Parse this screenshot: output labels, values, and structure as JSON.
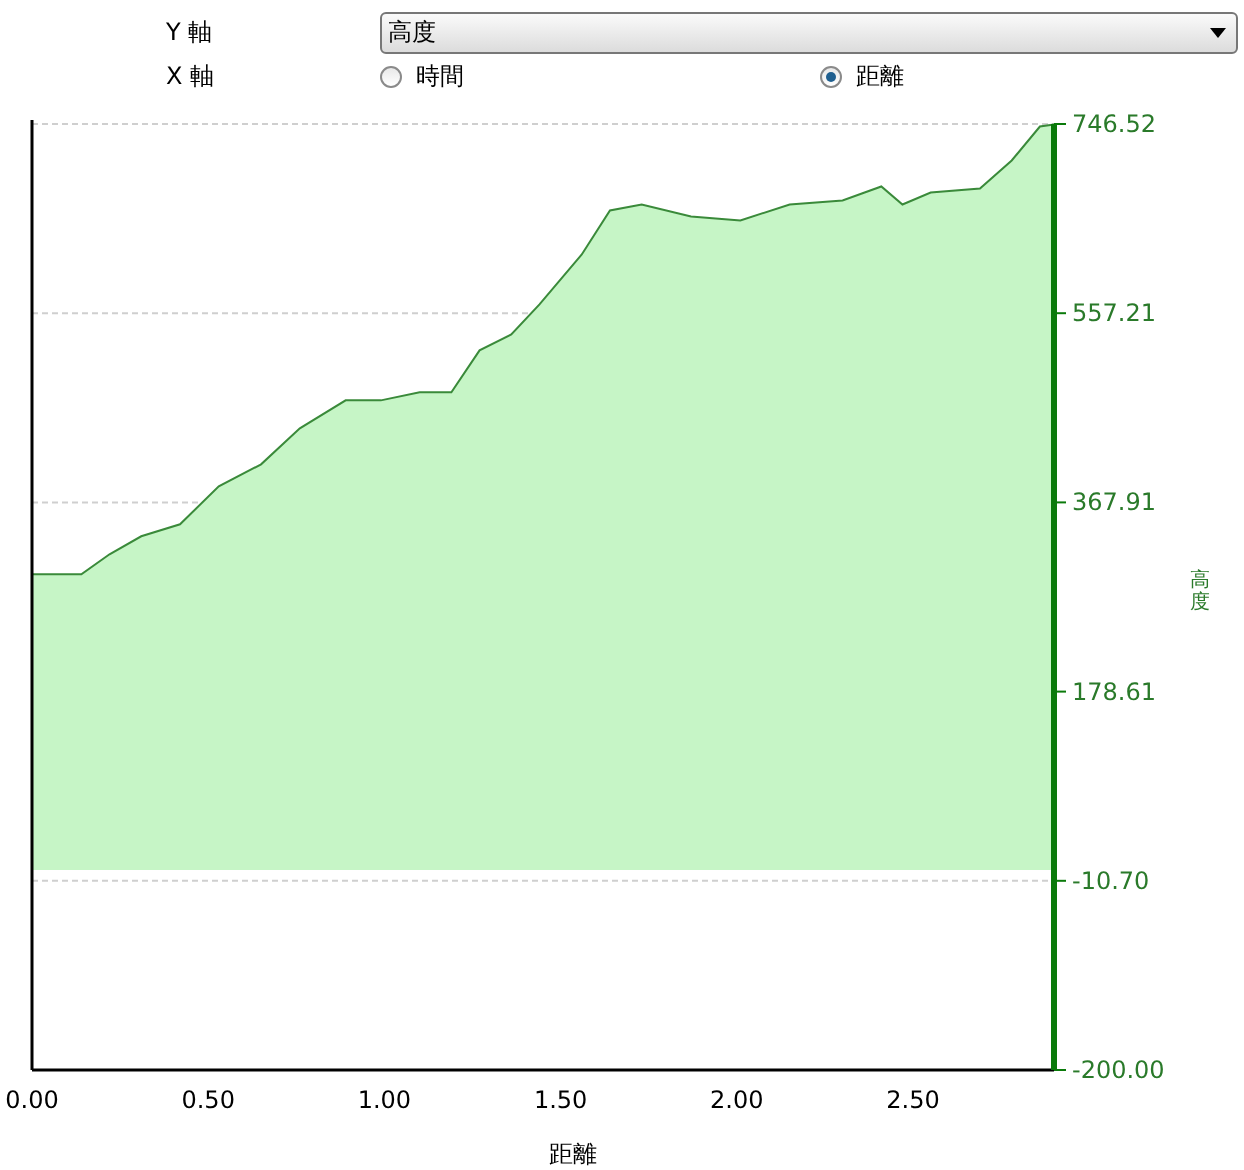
{
  "y_axis": {
    "label": "Y 軸",
    "select": {
      "value": "高度"
    }
  },
  "x_axis": {
    "label": "X 軸",
    "options": [
      {
        "label": "時間",
        "selected": false
      },
      {
        "label": "距離",
        "selected": true
      }
    ]
  },
  "chart": {
    "chart_data": {
      "type": "area",
      "xlabel": "距離",
      "ylabel": "高度",
      "x": [
        0,
        0.14,
        0.22,
        0.31,
        0.42,
        0.53,
        0.65,
        0.76,
        0.89,
        0.99,
        1.1,
        1.19,
        1.27,
        1.36,
        1.44,
        1.56,
        1.64,
        1.73,
        1.87,
        2.01,
        2.15,
        2.3,
        2.41,
        2.47,
        2.55,
        2.69,
        2.78,
        2.86,
        2.9
      ],
      "series": [
        {
          "color": "#3a8a3a",
          "values": [
            296,
            296,
            316,
            334,
            346,
            384,
            406,
            442,
            470,
            470,
            478,
            478,
            520,
            536,
            566,
            616,
            660,
            666,
            654,
            650,
            666,
            670,
            684,
            666,
            678,
            682,
            710,
            744,
            746
          ]
        }
      ],
      "grid": true,
      "xlim": [
        0,
        2.9
      ],
      "ylim": [
        -200,
        746.52
      ],
      "xticks": [
        {
          "value": 0,
          "label": "0.00"
        },
        {
          "value": 0.5,
          "label": "0.50"
        },
        {
          "value": 1,
          "label": "1.00"
        },
        {
          "value": 1.5,
          "label": "1.50"
        },
        {
          "value": 2,
          "label": "2.00"
        },
        {
          "value": 2.5,
          "label": "2.50"
        }
      ],
      "yticks": [
        {
          "value": 746.52,
          "label": "746.52"
        },
        {
          "value": 557.21,
          "label": "557.21"
        },
        {
          "value": 367.91,
          "label": "367.91"
        },
        {
          "value": 178.61,
          "label": "178.61"
        },
        {
          "value": -10.7,
          "label": "-10.70"
        },
        {
          "value": -200,
          "label": "-200.00"
        }
      ]
    }
  }
}
